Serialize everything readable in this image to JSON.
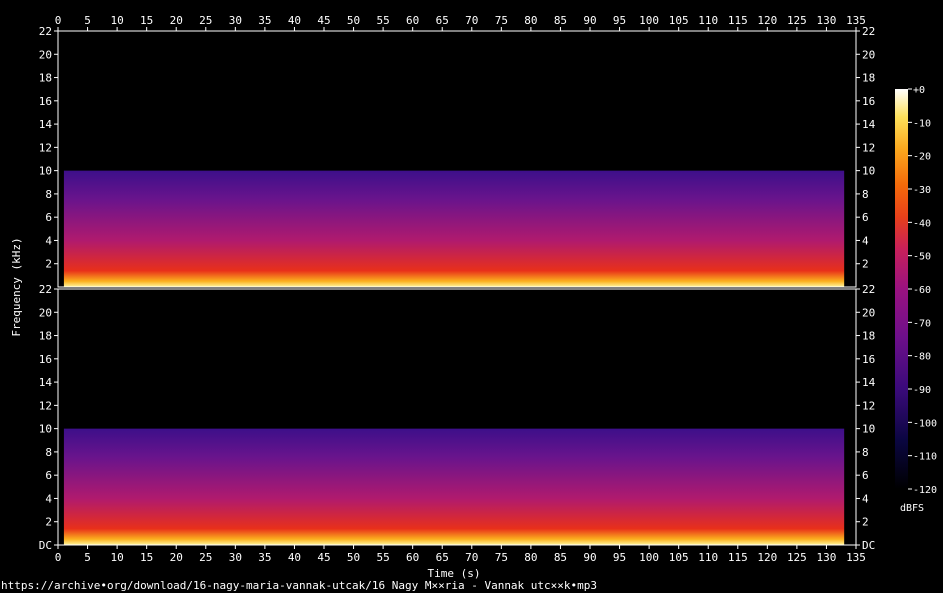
{
  "chart_data": {
    "type": "heatmap",
    "title": "",
    "xlabel": "Time (s)",
    "ylabel": "Frequency (kHz)",
    "xlim": [
      0,
      135
    ],
    "x_ticks": [
      "0",
      "5",
      "10",
      "15",
      "20",
      "25",
      "30",
      "35",
      "40",
      "45",
      "50",
      "55",
      "60",
      "65",
      "70",
      "75",
      "80",
      "85",
      "90",
      "95",
      "100",
      "105",
      "110",
      "115",
      "120",
      "125",
      "130",
      "135"
    ],
    "channels": [
      {
        "ylim": [
          0,
          22
        ],
        "y_tick_values": [
          2,
          4,
          6,
          8,
          10,
          12,
          14,
          16,
          18,
          20,
          22
        ],
        "y_tick_labels_left": [
          "2",
          "4",
          "6",
          "8",
          "10",
          "12",
          "14",
          "16",
          "18",
          "20",
          "22"
        ],
        "y_tick_labels_right": [
          "2",
          "4",
          "6",
          "8",
          "10",
          "12",
          "14",
          "16",
          "18",
          "20",
          "22"
        ]
      },
      {
        "ylim": [
          0,
          22
        ],
        "y_tick_values": [
          0,
          2,
          4,
          6,
          8,
          10,
          12,
          14,
          16,
          18,
          20,
          22
        ],
        "y_tick_labels_left": [
          "DC",
          "2",
          "4",
          "6",
          "8",
          "10",
          "12",
          "14",
          "16",
          "18",
          "20",
          "22"
        ],
        "y_tick_labels_right": [
          "DC",
          "2",
          "4",
          "6",
          "8",
          "10",
          "12",
          "14",
          "16",
          "18",
          "20",
          "22"
        ]
      }
    ],
    "audio_duration_s": 133,
    "frequency_cutoff_khz": 10,
    "colorbar": {
      "label": "dBFS",
      "range": [
        -120,
        0
      ],
      "ticks": [
        "+0",
        "-10",
        "-20",
        "-30",
        "-40",
        "-50",
        "-60",
        "-70",
        "-80",
        "-90",
        "-100",
        "-110",
        "-120"
      ],
      "colors": [
        "#000000",
        "#0a0640",
        "#3a0a7a",
        "#6e0f8a",
        "#9a1280",
        "#c8205a",
        "#e8401a",
        "#f46a0a",
        "#fba81e",
        "#fde05a",
        "#ffffff"
      ]
    }
  },
  "footer": {
    "source": "https://archive•org/download/16-nagy-maria-vannak-utcak/16 Nagy M××ria - Vannak utc××k•mp3"
  }
}
